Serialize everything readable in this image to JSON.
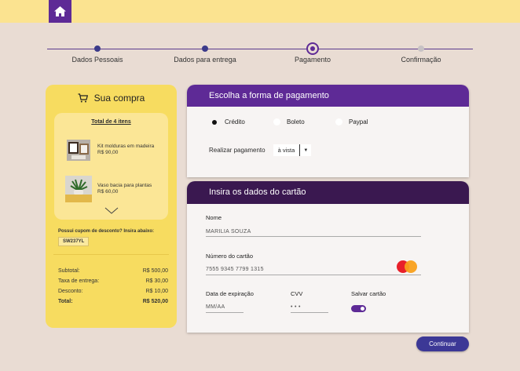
{
  "steps": [
    {
      "label": "Dados Pessoais",
      "state": "done"
    },
    {
      "label": "Dados para entrega",
      "state": "done"
    },
    {
      "label": "Pagamento",
      "state": "current"
    },
    {
      "label": "Confirmação",
      "state": "pending"
    }
  ],
  "cart": {
    "title": "Sua compra",
    "items_header": "Total de 4 itens",
    "items": [
      {
        "name": "Kit molduras em madeira",
        "price": "R$ 90,00"
      },
      {
        "name": "Vaso bacia para plantas",
        "price": "R$ 60,00"
      }
    ],
    "coupon_label": "Possui cupom de desconto? Insira abaixo:",
    "coupon_code": "SW237YL",
    "summary": [
      {
        "label": "Subtotal:",
        "value": "R$ 500,00"
      },
      {
        "label": "Taxa de entrega:",
        "value": "R$ 30,00"
      },
      {
        "label": "Desconto:",
        "value": "R$ 10,00"
      },
      {
        "label": "Total:",
        "value": "R$ 520,00"
      }
    ]
  },
  "payment": {
    "title": "Escolha a forma de pagamento",
    "options": [
      "Crédito",
      "Boleto",
      "Paypal"
    ],
    "selected_option": "Crédito",
    "installments_label": "Realizar pagamento",
    "installments_value": "à vista"
  },
  "card": {
    "title": "Insira os dados do cartão",
    "name_label": "Nome",
    "name_value": "MARILIA SOUZA",
    "number_label": "Número do cartão",
    "number_value": "7555  9345  7799  1315",
    "expiry_label": "Data de expiração",
    "expiry_placeholder": "MM/AA",
    "cvv_label": "CVV",
    "cvv_value": "• • •",
    "save_label": "Salvar cartão",
    "save_on": true
  },
  "continue_label": "Continuar",
  "colors": {
    "purple": "#5e2a96",
    "dark_purple": "#3a1850",
    "yellow": "#f7dc60",
    "button": "#3c3896"
  }
}
